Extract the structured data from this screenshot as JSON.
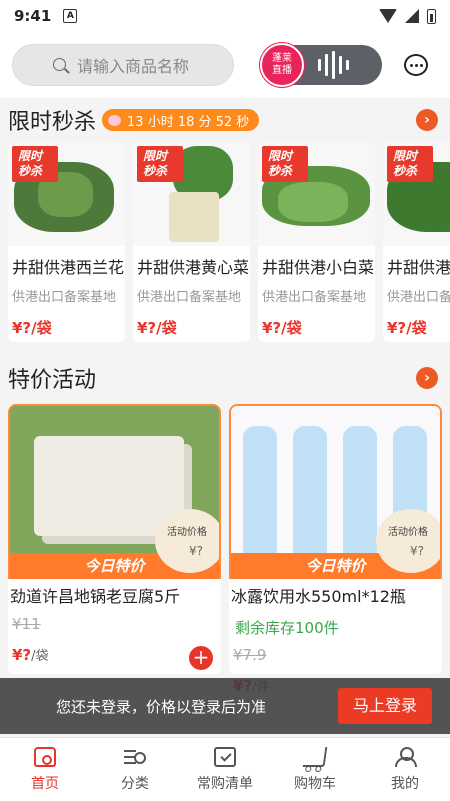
{
  "status_bar": {
    "time": "9:41",
    "notif_icon": "A"
  },
  "topbar": {
    "search_placeholder": "请输入商品名称",
    "live_label_line1": "蓬莱",
    "live_label_line2": "直播"
  },
  "flash_sale": {
    "title": "限时秒杀",
    "countdown": "13 小时 18 分 52 秒",
    "badge": [
      "限时",
      "秒杀"
    ],
    "items": [
      {
        "name": "井甜供港西兰花",
        "desc": "供港出口备案基地",
        "price": "¥?/袋"
      },
      {
        "name": "井甜供港黄心菜",
        "desc": "供港出口备案基地",
        "price": "¥?/袋"
      },
      {
        "name": "井甜供港小白菜",
        "desc": "供港出口备案基地",
        "price": "¥?/袋"
      },
      {
        "name": "井甜供港菜心",
        "desc": "供港出口备案基地",
        "price": "¥?/袋"
      }
    ]
  },
  "specials": {
    "title": "特价活动",
    "band": "今日特价",
    "act_price_label": "活动价格",
    "act_price_value": "¥?",
    "items": [
      {
        "name": "劲道许昌地锅老豆腐5斤",
        "old_price": "¥11",
        "price": "¥?",
        "unit": "/袋"
      },
      {
        "name": "冰露饮用水550ml*12瓶",
        "stock": "剩余库存100件",
        "old_price": "¥7.9",
        "price": "¥?",
        "unit": "/件"
      }
    ]
  },
  "login_bar": {
    "message": "您还未登录，价格以登录后为准",
    "button": "马上登录"
  },
  "tabs": [
    {
      "label": "首页",
      "icon": "home-icon"
    },
    {
      "label": "分类",
      "icon": "category-icon"
    },
    {
      "label": "常购清单",
      "icon": "list-icon"
    },
    {
      "label": "购物车",
      "icon": "cart-icon"
    },
    {
      "label": "我的",
      "icon": "profile-icon"
    }
  ],
  "colors": {
    "accent": "#e8342a",
    "orange": "#ff7a2a",
    "live": "#e8245a",
    "stock_green": "#3aa84a"
  }
}
